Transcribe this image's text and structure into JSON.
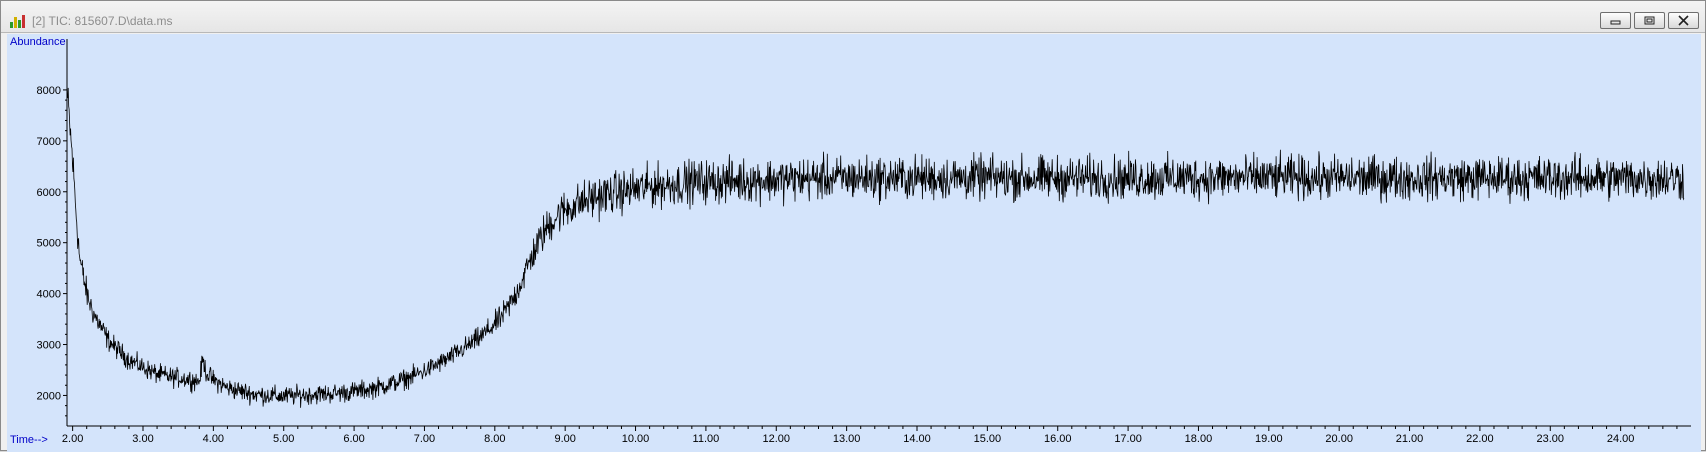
{
  "window": {
    "title": "[2] TIC: 815607.D\\data.ms",
    "icon": "chromatogram-app-icon",
    "controls": [
      "minimize-icon",
      "restore-icon",
      "close-icon"
    ]
  },
  "colors": {
    "plot_background": "#d4e4fb",
    "trace": "#000000",
    "axis_label": "#0000c8"
  },
  "chart_data": {
    "type": "line",
    "title": "",
    "xlabel": "Time-->",
    "ylabel": "Abundance",
    "xlim": [
      1.92,
      25.0
    ],
    "ylim": [
      1400,
      9000
    ],
    "grid": false,
    "x_ticks": [
      "2.00",
      "3.00",
      "4.00",
      "5.00",
      "6.00",
      "7.00",
      "8.00",
      "9.00",
      "10.00",
      "11.00",
      "12.00",
      "13.00",
      "14.00",
      "15.00",
      "16.00",
      "17.00",
      "18.00",
      "19.00",
      "20.00",
      "21.00",
      "22.00",
      "23.00",
      "24.00"
    ],
    "y_ticks": [
      "2000",
      "3000",
      "4000",
      "5000",
      "6000",
      "7000",
      "8000"
    ],
    "series": [
      {
        "x": [
          1.93,
          2.0,
          2.05,
          2.1,
          2.2,
          2.3,
          2.4,
          2.5,
          2.6,
          2.8,
          3.0,
          3.2,
          3.4,
          3.6,
          3.8,
          3.85,
          3.9,
          4.0,
          4.2,
          4.4,
          4.6,
          4.8,
          5.0,
          5.2,
          5.4,
          5.6,
          5.8,
          6.0,
          6.2,
          6.4,
          6.6,
          6.8,
          7.0,
          7.2,
          7.4,
          7.6,
          7.8,
          8.0,
          8.1,
          8.2,
          8.3,
          8.4,
          8.5,
          8.6,
          8.7,
          8.8,
          8.9,
          9.0,
          9.2,
          9.4,
          9.6,
          9.8,
          10.0,
          10.2,
          10.4,
          10.6,
          10.8,
          11.0,
          11.5,
          12.0,
          12.5,
          13.0,
          14.0,
          15.0,
          16.0,
          17.0,
          18.0,
          19.0,
          20.0,
          21.0,
          22.0,
          23.0,
          24.0,
          24.9
        ],
        "y": [
          7800,
          6600,
          5600,
          4700,
          4000,
          3600,
          3350,
          3100,
          2950,
          2700,
          2550,
          2420,
          2360,
          2330,
          2280,
          2700,
          2450,
          2300,
          2150,
          2080,
          2020,
          2000,
          1980,
          2000,
          2020,
          2030,
          2050,
          2080,
          2120,
          2180,
          2260,
          2360,
          2480,
          2620,
          2780,
          2960,
          3150,
          3400,
          3550,
          3750,
          4000,
          4300,
          4650,
          4950,
          5200,
          5400,
          5550,
          5650,
          5780,
          5880,
          5950,
          6000,
          6050,
          6100,
          6130,
          6160,
          6190,
          6200,
          6220,
          6240,
          6260,
          6270,
          6270,
          6270,
          6270,
          6270,
          6270,
          6280,
          6270,
          6270,
          6270,
          6270,
          6270,
          6260
        ],
        "noise_amplitude": 420
      }
    ]
  }
}
